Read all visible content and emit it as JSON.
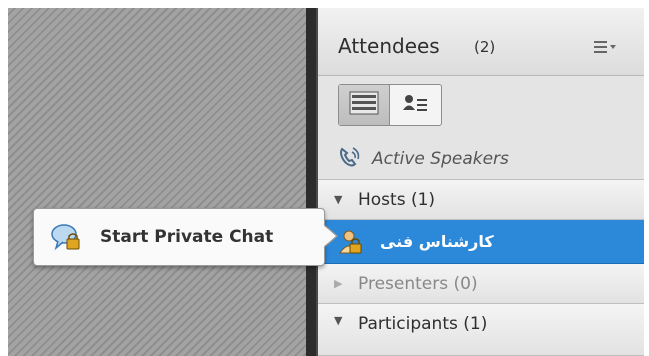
{
  "panel": {
    "title": "Attendees",
    "count": "(2)",
    "menu_icon": "list-menu-icon"
  },
  "view_toggle": {
    "list_icon": "list-view-icon",
    "card_icon": "attendee-card-icon"
  },
  "active_speakers": {
    "label": "Active Speakers",
    "icon": "phone-speaking-icon"
  },
  "sections": {
    "hosts": "Hosts (1)",
    "presenters": "Presenters (0)",
    "participants": "Participants (1)"
  },
  "host_user": {
    "name": "کارشناس فنی",
    "icon": "host-avatar-lock-icon"
  },
  "context_popup": {
    "label": "Start Private Chat",
    "icon": "private-chat-bubble-lock-icon"
  },
  "colors": {
    "selection": "#2c88d9",
    "panel_bg": "#d6d6d6"
  }
}
